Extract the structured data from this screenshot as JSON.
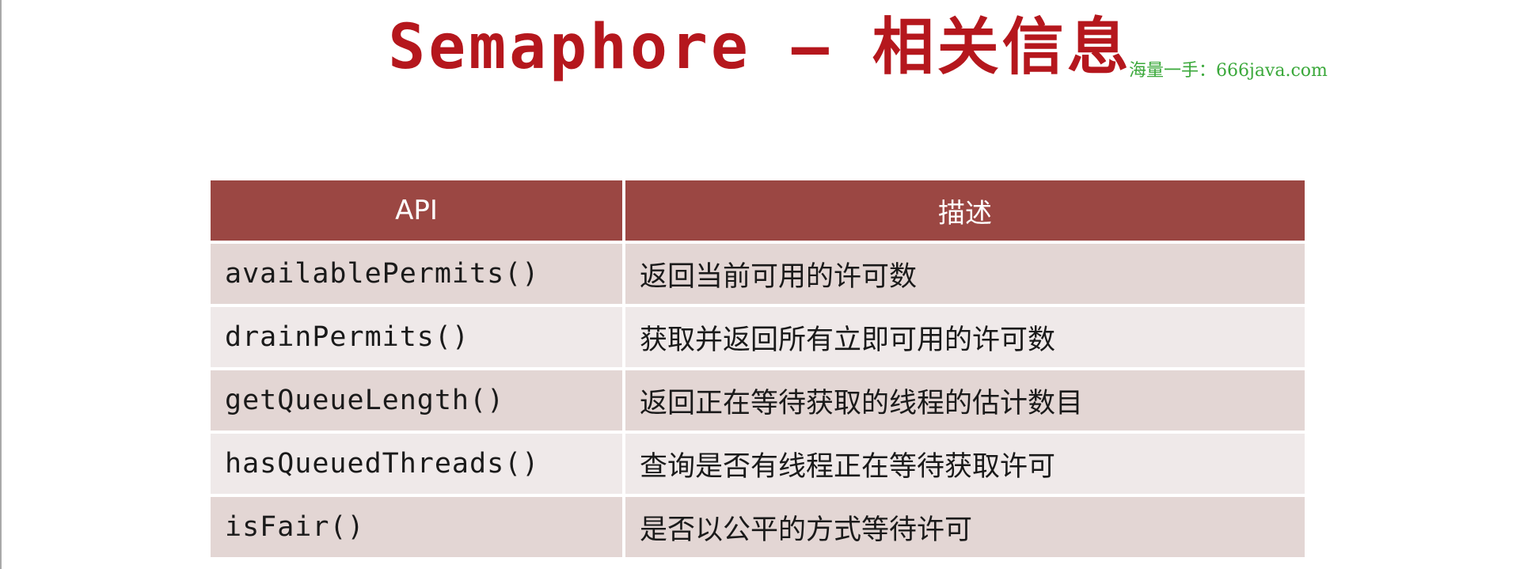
{
  "slide": {
    "title": "Semaphore – 相关信息",
    "watermark": "海量一手：666java.com"
  },
  "table": {
    "headers": [
      "API",
      "描述"
    ],
    "rows": [
      {
        "api": "availablePermits()",
        "desc": "返回当前可用的许可数"
      },
      {
        "api": "drainPermits()",
        "desc": "获取并返回所有立即可用的许可数"
      },
      {
        "api": "getQueueLength()",
        "desc": "返回正在等待获取的线程的估计数目"
      },
      {
        "api": "hasQueuedThreads()",
        "desc": "查询是否有线程正在等待获取许可"
      },
      {
        "api": "isFair()",
        "desc": "是否以公平的方式等待许可"
      }
    ]
  },
  "colors": {
    "title": "#b5171d",
    "header_bg": "#9b4743",
    "row_odd_bg": "#e3d6d4",
    "row_even_bg": "#efe9e9",
    "watermark": "#3aa83a"
  }
}
